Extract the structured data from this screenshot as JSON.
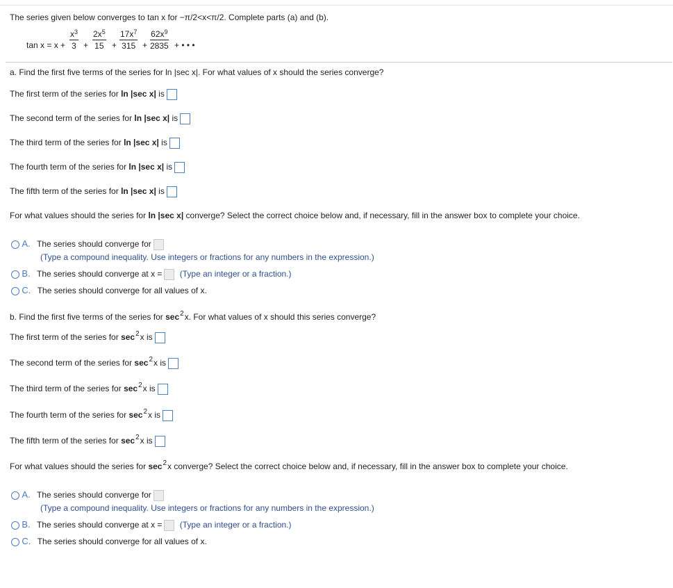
{
  "intro": "The series given below converges to tan x for −π/2<x<π/2. Complete parts (a) and (b).",
  "formula": {
    "lhs": "tan x = x +",
    "terms": [
      {
        "num": "x",
        "exp": "3",
        "den": "3"
      },
      {
        "num": "2x",
        "exp": "5",
        "den": "15"
      },
      {
        "num": "17x",
        "exp": "7",
        "den": "315"
      },
      {
        "num": "62x",
        "exp": "9",
        "den": "2835"
      }
    ],
    "plus": "+",
    "ellipsis": "+ • • •"
  },
  "part_a": {
    "question": "a. Find the first five terms of the series for ln |sec x|. For what values of x should the series converge?",
    "terms": [
      {
        "prefix": "The first term of the series for ",
        "func": "ln |sec x|",
        "suffix": " is"
      },
      {
        "prefix": "The second term of the series for ",
        "func": "ln |sec x|",
        "suffix": " is"
      },
      {
        "prefix": "The third term of the series for ",
        "func": "ln |sec x|",
        "suffix": " is"
      },
      {
        "prefix": "The fourth term of the series for ",
        "func": "ln |sec x|",
        "suffix": " is"
      },
      {
        "prefix": "The fifth term of the series for ",
        "func": "ln |sec x|",
        "suffix": " is"
      }
    ],
    "converge_prefix": "For what values should the series for ",
    "converge_func": "ln |sec x|",
    "converge_suffix": " converge? Select the correct choice below and, if necessary, fill in the answer box to complete your choice.",
    "choices": {
      "a_letter": "A.",
      "a_text": "The series should converge for",
      "a_hint": "(Type a compound inequality. Use integers or fractions for any numbers in the expression.)",
      "b_letter": "B.",
      "b_text": "The series should converge at x =",
      "b_hint": "(Type an integer or a fraction.)",
      "c_letter": "C.",
      "c_text": "The series should converge for all values of x."
    }
  },
  "part_b": {
    "question_prefix": "b. Find the first five terms of the series for ",
    "func": "sec",
    "exp": "2",
    "var": "x",
    "question_suffix": ". For what values of x should this series converge?",
    "terms": [
      {
        "prefix": "The first term of the series for ",
        "suffix": " is"
      },
      {
        "prefix": "The second term of the series for ",
        "suffix": " is"
      },
      {
        "prefix": "The third term of the series for ",
        "suffix": " is"
      },
      {
        "prefix": "The fourth term of the series for ",
        "suffix": " is"
      },
      {
        "prefix": "The fifth term of the series for ",
        "suffix": " is"
      }
    ],
    "converge_prefix": "For what values should the series for ",
    "converge_suffix": " converge? Select the correct choice below and, if necessary, fill in the answer box to complete your choice.",
    "choices": {
      "a_letter": "A.",
      "a_text": "The series should converge for",
      "a_hint": "(Type a compound inequality. Use integers or fractions for any numbers in the expression.)",
      "b_letter": "B.",
      "b_text": "The series should converge at x =",
      "b_hint": "(Type an integer or a fraction.)",
      "c_letter": "C.",
      "c_text": "The series should converge for all values of x."
    }
  }
}
